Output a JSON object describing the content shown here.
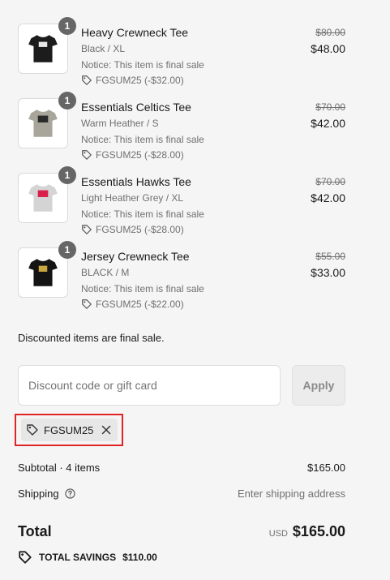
{
  "items": [
    {
      "qty": "1",
      "name": "Heavy Crewneck Tee",
      "variant": "Black / XL",
      "notice": "Notice: This item is final sale",
      "discount": "FGSUM25 (-$32.00)",
      "original_price": "$80.00",
      "price": "$48.00",
      "shirt_color": "#1c1c1c",
      "print_color": "#e8e8e8"
    },
    {
      "qty": "1",
      "name": "Essentials Celtics Tee",
      "variant": "Warm Heather / S",
      "notice": "Notice: This item is final sale",
      "discount": "FGSUM25 (-$28.00)",
      "original_price": "$70.00",
      "price": "$42.00",
      "shirt_color": "#a8a69a",
      "print_color": "#2a2a2a"
    },
    {
      "qty": "1",
      "name": "Essentials Hawks Tee",
      "variant": "Light Heather Grey / XL",
      "notice": "Notice: This item is final sale",
      "discount": "FGSUM25 (-$28.00)",
      "original_price": "$70.00",
      "price": "$42.00",
      "shirt_color": "#d4d4d4",
      "print_color": "#d8204a"
    },
    {
      "qty": "1",
      "name": "Jersey Crewneck Tee",
      "variant": "BLACK / M",
      "notice": "Notice: This item is final sale",
      "discount": "FGSUM25 (-$22.00)",
      "original_price": "$55.00",
      "price": "$33.00",
      "shirt_color": "#141414",
      "print_color": "#c9a640"
    }
  ],
  "final_sale_note": "Discounted items are final sale.",
  "discount_field": {
    "placeholder": "Discount code or gift card",
    "value": ""
  },
  "apply_label": "Apply",
  "applied_code": "FGSUM25",
  "subtotal_label": "Subtotal · 4 items",
  "subtotal_value": "$165.00",
  "shipping_label": "Shipping",
  "shipping_value": "Enter shipping address",
  "total_label": "Total",
  "currency": "USD",
  "total_value": "$165.00",
  "savings_label": "TOTAL SAVINGS",
  "savings_value": "$110.00",
  "icons": {
    "tag": "tag-icon",
    "help": "help-circle-icon",
    "close": "close-icon",
    "savings": "savings-tag-icon"
  },
  "colors": {
    "background": "#f5f5f5",
    "highlight_border": "#e02424",
    "badge": "#666666"
  }
}
